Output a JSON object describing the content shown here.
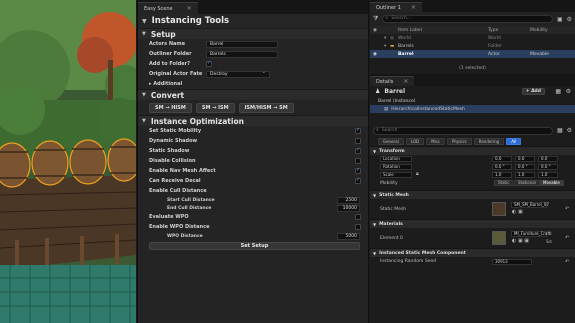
{
  "tool": {
    "tab_label": "Easy Scene",
    "title": "Instancing Tools",
    "sections": {
      "setup": "Setup",
      "convert": "Convert",
      "optimization": "Instance Optimization"
    },
    "setup": {
      "actors_name_label": "Actors Name",
      "actors_name_value": "Barrel",
      "outliner_folder_label": "Outliner Folder",
      "outliner_folder_value": "Barrels",
      "add_to_folder_label": "Add to Folder?",
      "add_to_folder_checked": true,
      "original_actor_fate_label": "Original Actor Fate",
      "original_actor_fate_value": "Destroy",
      "additional_label": "Additional"
    },
    "convert": {
      "btn_sm_hism": "SM → HISM",
      "btn_sm_ism": "SM → ISM",
      "btn_ism_hism_sm": "ISM/HISM → SM"
    },
    "optimization": {
      "set_static_mobility": "Set Static Mobility",
      "dynamic_shadow": "Dynamic Shadow",
      "static_shadow": "Static Shadow",
      "disable_collision": "Disable Collision",
      "enable_nav_mesh_affect": "Enable Nav Mesh Affect",
      "can_receive_decal": "Can Receive Decal",
      "enable_cull_distance": "Enable Cull Distance",
      "start_cull_distance_label": "Start Cull Distance",
      "start_cull_distance_value": "2500",
      "end_cull_distance_label": "End Cull Distance",
      "end_cull_distance_value": "10000",
      "evaluate_wpo": "Evaluate WPO",
      "enable_wpo_distance": "Enable WPO Distance",
      "wpo_distance_label": "WPO Distance",
      "wpo_distance_value": "5000",
      "set_setup_label": "Set Setup"
    }
  },
  "outliner": {
    "tab_label": "Outliner 1",
    "search_placeholder": "Search...",
    "columns": {
      "item_label": "Item Label",
      "type": "Type",
      "mobility": "Mobility"
    },
    "rows": [
      {
        "label": "World",
        "type": "World",
        "mobility": ""
      },
      {
        "label": "Barrels",
        "type": "Folder",
        "mobility": ""
      },
      {
        "label": "Barrel",
        "type": "Actor",
        "mobility": "Movable"
      }
    ],
    "status": "(1 selected)"
  },
  "details": {
    "tab_label": "Details",
    "actor_name": "Barrel",
    "add_label": "+ Add",
    "components": [
      "Barrel (Instance)",
      "HierarchicalInstancedStaticMesh"
    ],
    "search_placeholder": "Search",
    "filters": [
      "General",
      "LOD",
      "Misc",
      "Physics",
      "Rendering",
      "All"
    ],
    "transform": {
      "section": "Transform",
      "location_label": "Location",
      "rotation_label": "Rotation",
      "scale_label": "Scale",
      "location": [
        "0.0",
        "0.0",
        "0.0"
      ],
      "rotation": [
        "0.0 °",
        "0.0 °",
        "0.0 °"
      ],
      "scale": [
        "1.0",
        "1.0",
        "1.0"
      ],
      "mobility_label": "Mobility",
      "mobility_options": [
        "Static",
        "Stationar",
        "Movable"
      ]
    },
    "static_mesh": {
      "section": "Static Mesh",
      "label": "Static Mesh",
      "value": "SM_SM_Barrel_07"
    },
    "materials": {
      "section": "Materials",
      "label": "Element 0",
      "value": "MI_Furniture_Crafti",
      "source_label": "Src"
    },
    "ism_component": {
      "section": "Instanced Static Mesh Component",
      "seed_label": "Instancing Random Seed",
      "seed_value": "30913"
    }
  },
  "colors": {
    "accent": "#2b6cd8",
    "selection": "#2a3f5f",
    "panel": "#242424"
  }
}
